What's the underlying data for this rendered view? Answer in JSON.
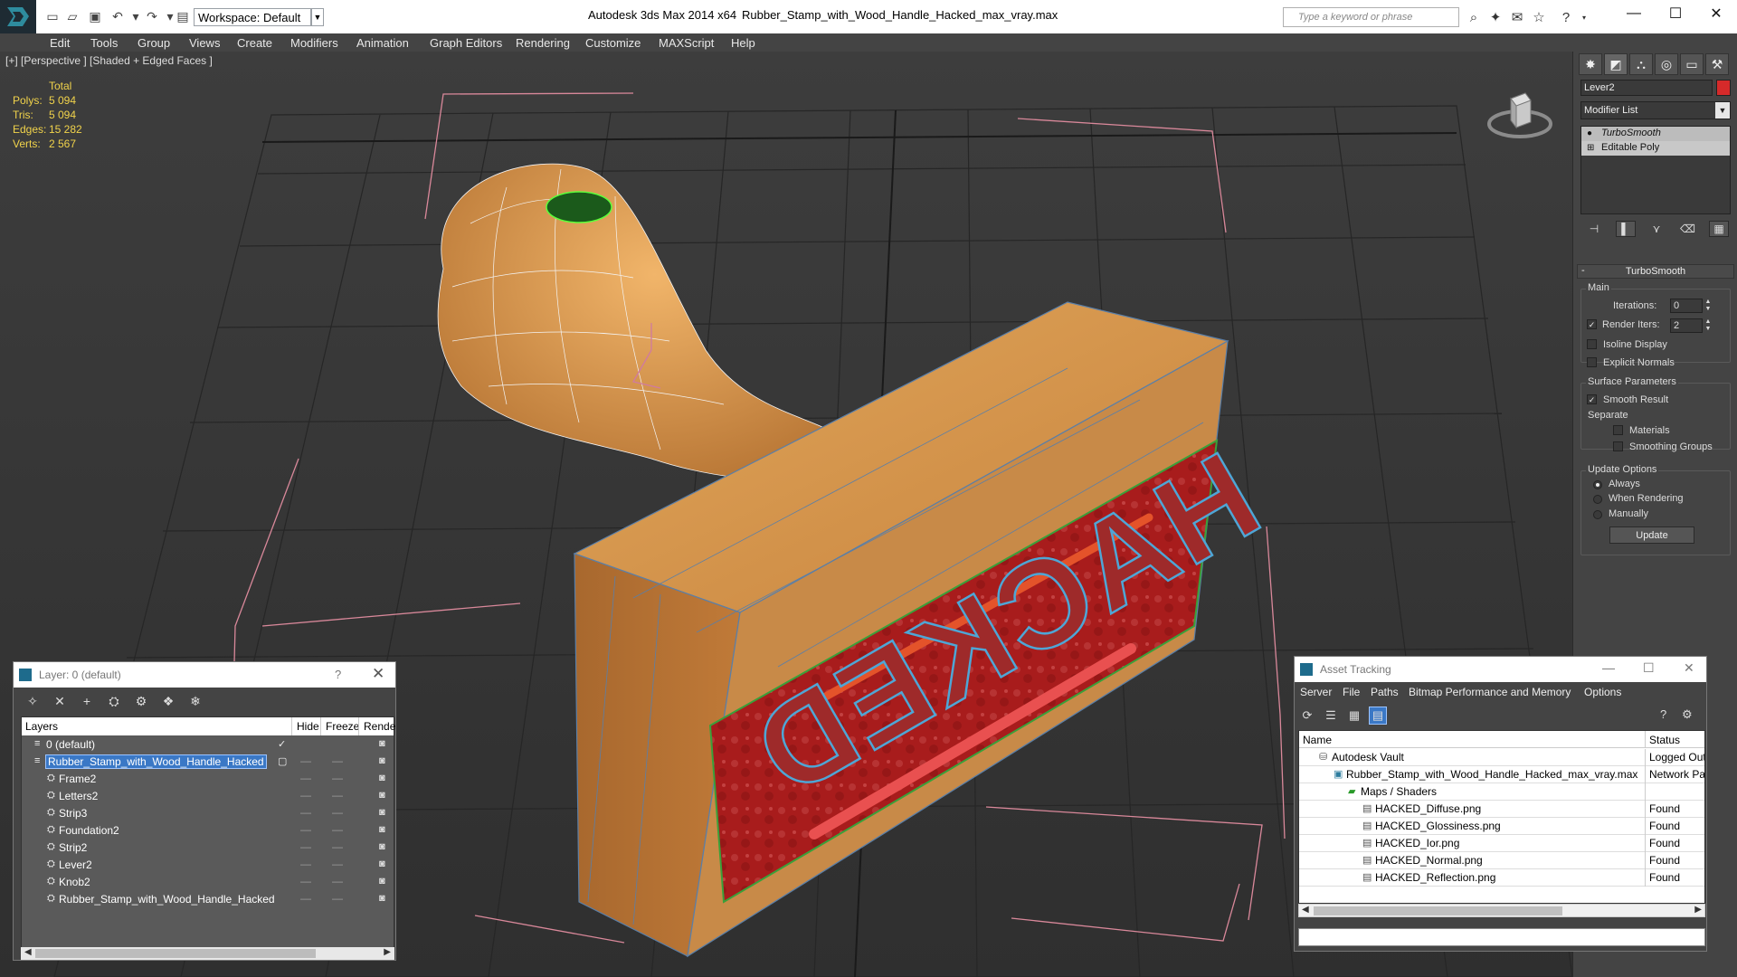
{
  "titlebar": {
    "workspace": "Workspace: Default",
    "app_title": "Autodesk 3ds Max  2014 x64",
    "file_title": "Rubber_Stamp_with_Wood_Handle_Hacked_max_vray.max",
    "search_placeholder": "Type a keyword or phrase"
  },
  "menu": [
    "Edit",
    "Tools",
    "Group",
    "Views",
    "Create",
    "Modifiers",
    "Animation",
    "Graph Editors",
    "Rendering",
    "Customize",
    "MAXScript",
    "Help"
  ],
  "viewport": {
    "label": "[+] [Perspective ] [Shaded + Edged Faces ]",
    "stats": {
      "header": "Total",
      "rows": [
        {
          "label": "Polys:",
          "value": "5 094"
        },
        {
          "label": "Tris:",
          "value": "5 094"
        },
        {
          "label": "Edges:",
          "value": "15 282"
        },
        {
          "label": "Verts:",
          "value": "2 567"
        }
      ]
    },
    "stamp_text": "HACKED"
  },
  "command_panel": {
    "object_name": "Lever2",
    "object_color": "#d52a2a",
    "modifier_list": "Modifier List",
    "stack": [
      "TurboSmooth",
      "Editable Poly"
    ],
    "rollout_title": "TurboSmooth",
    "main_group": "Main",
    "iterations_label": "Iterations:",
    "iterations_value": "0",
    "render_iters_label": "Render Iters:",
    "render_iters_value": "2",
    "isoline_label": "Isoline Display",
    "explicit_label": "Explicit Normals",
    "surface_group": "Surface Parameters",
    "smooth_result": "Smooth Result",
    "separate_label": "Separate",
    "materials_label": "Materials",
    "smoothing_groups_label": "Smoothing Groups",
    "update_group": "Update Options",
    "always_label": "Always",
    "when_rendering_label": "When Rendering",
    "manually_label": "Manually",
    "update_button": "Update"
  },
  "layer_dialog": {
    "title": "Layer: 0 (default)",
    "help": "?",
    "columns": [
      "Layers",
      "Hide",
      "Freeze",
      "Rende"
    ],
    "rows": [
      {
        "name": "0 (default)",
        "indent": 1,
        "selected": false,
        "check": true
      },
      {
        "name": "Rubber_Stamp_with_Wood_Handle_Hacked",
        "indent": 1,
        "selected": true,
        "check": false
      },
      {
        "name": "Frame2",
        "indent": 2,
        "selected": false,
        "check": false
      },
      {
        "name": "Letters2",
        "indent": 2,
        "selected": false,
        "check": false
      },
      {
        "name": "Strip3",
        "indent": 2,
        "selected": false,
        "check": false
      },
      {
        "name": "Foundation2",
        "indent": 2,
        "selected": false,
        "check": false
      },
      {
        "name": "Strip2",
        "indent": 2,
        "selected": false,
        "check": false
      },
      {
        "name": "Lever2",
        "indent": 2,
        "selected": false,
        "check": false
      },
      {
        "name": "Knob2",
        "indent": 2,
        "selected": false,
        "check": false
      },
      {
        "name": "Rubber_Stamp_with_Wood_Handle_Hacked",
        "indent": 2,
        "selected": false,
        "check": false
      }
    ]
  },
  "asset_dialog": {
    "title": "Asset Tracking",
    "menu": [
      "Server",
      "File",
      "Paths",
      "Bitmap Performance and Memory",
      "Options"
    ],
    "columns": [
      "Name",
      "Status"
    ],
    "rows": [
      {
        "name": "Autodesk Vault",
        "indent": 1,
        "status": "Logged Out"
      },
      {
        "name": "Rubber_Stamp_with_Wood_Handle_Hacked_max_vray.max",
        "indent": 2,
        "status": "Network Pa"
      },
      {
        "name": "Maps / Shaders",
        "indent": 3,
        "status": ""
      },
      {
        "name": "HACKED_Diffuse.png",
        "indent": 4,
        "status": "Found"
      },
      {
        "name": "HACKED_Glossiness.png",
        "indent": 4,
        "status": "Found"
      },
      {
        "name": "HACKED_Ior.png",
        "indent": 4,
        "status": "Found"
      },
      {
        "name": "HACKED_Normal.png",
        "indent": 4,
        "status": "Found"
      },
      {
        "name": "HACKED_Reflection.png",
        "indent": 4,
        "status": "Found"
      }
    ]
  }
}
